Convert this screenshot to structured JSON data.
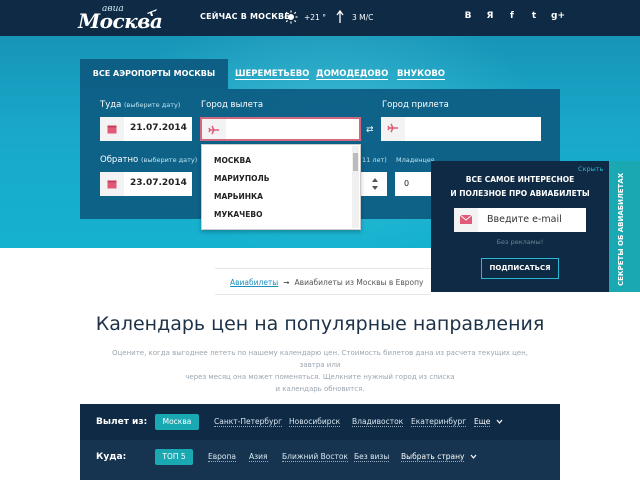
{
  "header": {
    "logo_small": "авиа",
    "logo_big": "Москва",
    "weather_label": "СЕЙЧАС В МОСКВЕ:",
    "temperature": "+21 °",
    "wind": "3 М/С",
    "social": [
      "В",
      "Я",
      "f",
      "t",
      "g+"
    ]
  },
  "tabs": {
    "active": "ВСЕ АЭРОПОРТЫ МОСКВЫ",
    "items": [
      "ШЕРЕМЕТЬЕВО",
      "ДОМОДЕДОВО",
      "ВНУКОВО"
    ]
  },
  "form": {
    "there_label": "Туда",
    "there_hint": "(выберите дату)",
    "there_date": "21.07.2014",
    "from_label": "Город вылета",
    "from_value": "",
    "to_label": "Город прилета",
    "to_value": "",
    "back_label": "Обратно",
    "back_hint": "(выберите дату)",
    "back_date": "23.07.2014",
    "children_hint": "11 лет)",
    "infants_label": "Младенцев",
    "infants_value": "0",
    "swap_symbol": "⇄"
  },
  "dropdown": {
    "items": [
      "МОСКВА",
      "МАРИУПОЛЬ",
      "МАРЬИНКА",
      "МУКАЧЕВО"
    ]
  },
  "subscribe": {
    "hide": "Скрыть",
    "title_line1": "ВСЕ САМОЕ ИНТЕРЕСНОЕ",
    "title_line2": "И ПОЛЕЗНОЕ ПРО АВИАБИЛЕТЫ",
    "email_placeholder": "Введите e-mail",
    "no_ads": "Без рекламы!",
    "button": "ПОДПИСАТЬСЯ",
    "side_tab": "СЕКРЕТЫ ОБ АВИАБИЛЕТАХ"
  },
  "breadcrumbs": {
    "link": "Авиабилеты",
    "arrow": "➞",
    "current": "Авиабилеты из Москвы в Европу"
  },
  "page": {
    "title": "Календарь цен на популярные направления",
    "desc_line1": "Оцените, когда выгоднее лететь по нашему календарю цен. Стоимость билетов дана из расчета текущих цен, завтра или",
    "desc_line2": "через месяц она может поменяться. Щелкните нужный город из списка",
    "desc_line3": "и календарь обновится."
  },
  "filter": {
    "from_label": "Вылет из:",
    "from_active": "Москва",
    "from_items": [
      "Санкт-Петербург",
      "Новосибирск",
      "Владивосток",
      "Екатеринбург"
    ],
    "from_more": "Еще",
    "to_label": "Куда:",
    "to_active": "ТОП 5",
    "to_items": [
      "Европа",
      "Азия",
      "Ближний Восток",
      "Без визы"
    ],
    "to_more": "Выбрать страну"
  },
  "colors": {
    "header_bg": "#0f2a44",
    "hero": "#19a8c9",
    "panel": "#0e5f85",
    "accent": "#1aa9b3",
    "active_border": "#d1687f"
  }
}
